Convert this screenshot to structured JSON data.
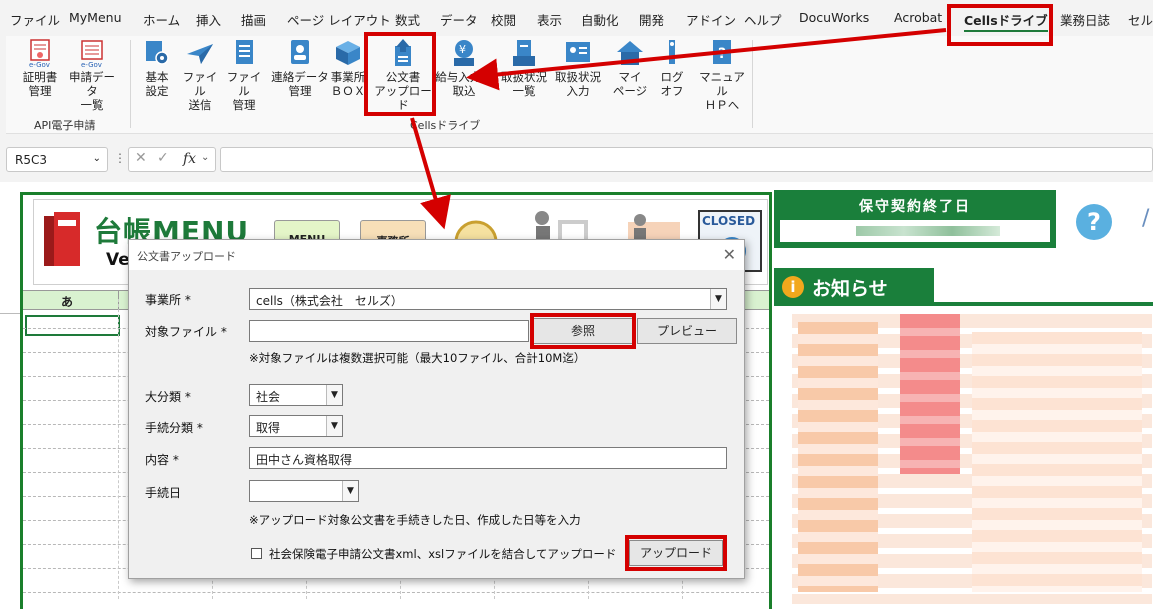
{
  "menubar": {
    "tabs": [
      "ファイル",
      "MyMenu",
      "ホーム",
      "挿入",
      "描画",
      "ページ レイアウト",
      "数式",
      "データ",
      "校閲",
      "表示",
      "自動化",
      "開発",
      "アドイン",
      "ヘルプ",
      "DocuWorks",
      "Acrobat",
      "Cellsドライブ",
      "業務日誌",
      "セル"
    ],
    "active_tab": "Cellsドライブ"
  },
  "ribbon": {
    "buttons": [
      {
        "label1": "証明書",
        "label2": "管理",
        "icon": "certificate-icon"
      },
      {
        "label1": "申請データ",
        "label2": "一覧",
        "icon": "application-list-icon"
      },
      {
        "label1": "基本",
        "label2": "設定",
        "icon": "gear-icon"
      },
      {
        "label1": "ファイル",
        "label2": "送信",
        "icon": "send-icon"
      },
      {
        "label1": "ファイル",
        "label2": "管理",
        "icon": "file-manage-icon"
      },
      {
        "label1": "連絡データ",
        "label2": "管理",
        "icon": "contact-icon"
      },
      {
        "label1": "事業所",
        "label2": "ＢＯＸ",
        "icon": "box-icon"
      },
      {
        "label1": "公文書",
        "label2": "アップロード",
        "icon": "upload-icon"
      },
      {
        "label1": "給与入力表",
        "label2": "取込",
        "icon": "salary-import-icon"
      },
      {
        "label1": "取扱状況",
        "label2": "一覧",
        "icon": "status-list-icon"
      },
      {
        "label1": "取扱状況",
        "label2": "入力",
        "icon": "status-input-icon"
      },
      {
        "label1": "マイ",
        "label2": "ページ",
        "icon": "home-icon"
      },
      {
        "label1": "ログ",
        "label2": "オフ",
        "icon": "logoff-icon"
      },
      {
        "label1": "マニュアル",
        "label2": "ＨＰへ",
        "icon": "manual-icon"
      }
    ],
    "group1_label": "API電子申請",
    "group2_label": "Cellsドライブ"
  },
  "formula_bar": {
    "name_box": "R5C3",
    "fx": "fx"
  },
  "sheet": {
    "title": "台帳MENU",
    "version": "Ver.",
    "tiles": [
      "MENU",
      "事務所"
    ],
    "closed_label": "CLOSED",
    "col_header": "あ"
  },
  "right_panel": {
    "contract_title": "保守契約終了日",
    "help": "?",
    "notice_icon": "i",
    "notice_label": "お知らせ"
  },
  "dialog": {
    "title": "公文書アップロード",
    "close": "✕",
    "office_label": "事業所 *",
    "office_value": "cells（株式会社　セルズ）",
    "file_label": "対象ファイル *",
    "file_value": "",
    "browse_button": "参照",
    "preview_button": "プレビュー",
    "file_note": "※対象ファイルは複数選択可能（最大10ファイル、合計10M迄）",
    "category_label": "大分類 *",
    "category_value": "社会",
    "procedure_label": "手続分類 *",
    "procedure_value": "取得",
    "content_label": "内容 *",
    "content_value": "田中さん資格取得",
    "date_label": "手続日",
    "date_value": "",
    "date_note": "※アップロード対象公文書を手続きした日、作成した日等を入力",
    "merge_checkbox_label": "社会保険電子申請公文書xml、xslファイルを結合してアップロード",
    "upload_button": "アップロード"
  },
  "colors": {
    "accent_green": "#1a7f3b",
    "highlight_red": "#d40000"
  }
}
